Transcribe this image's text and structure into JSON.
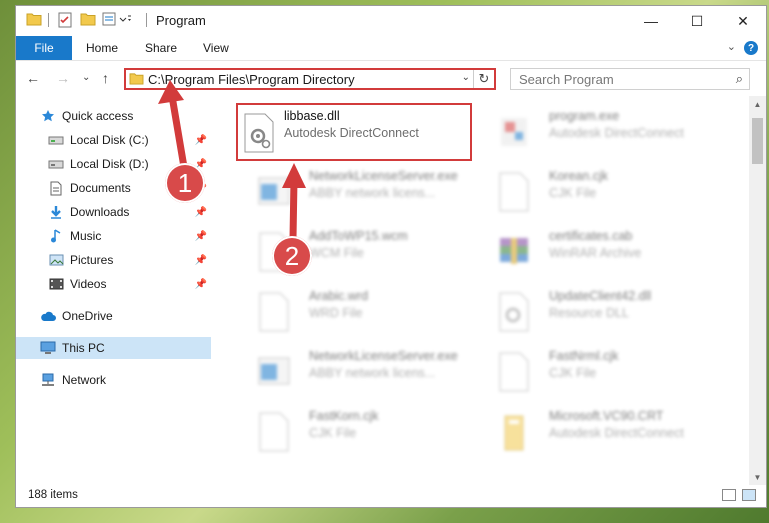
{
  "window": {
    "title": "Program",
    "minimize_glyph": "—",
    "maximize_glyph": "☐",
    "close_glyph": "✕"
  },
  "ribbon": {
    "tabs": [
      "File",
      "Home",
      "Share",
      "View"
    ],
    "help_glyph": "?",
    "collapse_glyph": "⌄"
  },
  "address": {
    "path": "C:\\Program Files\\Program Directory",
    "dropdown_glyph": "⌄",
    "refresh_glyph": "↻"
  },
  "search": {
    "placeholder": "Search Program",
    "icon": "search-icon"
  },
  "nav": {
    "back": "←",
    "forward": "→",
    "recent": "⌄",
    "up": "↑"
  },
  "sidebar": {
    "items": [
      {
        "label": "Quick access",
        "icon": "star-icon",
        "pinned": false,
        "selected": false
      },
      {
        "label": "Local Disk (C:)",
        "icon": "drive-icon",
        "pinned": true,
        "selected": false
      },
      {
        "label": "Local Disk (D:)",
        "icon": "drive-icon",
        "pinned": true,
        "selected": false
      },
      {
        "label": "Documents",
        "icon": "documents-icon",
        "pinned": true,
        "selected": false
      },
      {
        "label": "Downloads",
        "icon": "download-icon",
        "pinned": true,
        "selected": false
      },
      {
        "label": "Music",
        "icon": "music-icon",
        "pinned": true,
        "selected": false
      },
      {
        "label": "Pictures",
        "icon": "pictures-icon",
        "pinned": true,
        "selected": false
      },
      {
        "label": "Videos",
        "icon": "videos-icon",
        "pinned": true,
        "selected": false
      },
      {
        "label": "OneDrive",
        "icon": "cloud-icon",
        "pinned": false,
        "selected": false
      },
      {
        "label": "This PC",
        "icon": "computer-icon",
        "pinned": false,
        "selected": true
      },
      {
        "label": "Network",
        "icon": "network-icon",
        "pinned": false,
        "selected": false
      }
    ]
  },
  "files": [
    {
      "name": "libbase.dll",
      "type": "Autodesk DirectConnect",
      "icon": "dll-gear-icon",
      "highlighted": true
    },
    {
      "name": "program.exe",
      "type": "Autodesk DirectConnect",
      "icon": "exe-icon",
      "highlighted": false
    },
    {
      "name": "NetworkLicenseServer.exe",
      "type": "ABBY network licens...",
      "icon": "window-app-icon",
      "highlighted": false
    },
    {
      "name": "Korean.cjk",
      "type": "CJK File",
      "icon": "blank-file-icon",
      "highlighted": false
    },
    {
      "name": "AddToWP15.wcm",
      "type": "WCM File",
      "icon": "blank-file-icon",
      "highlighted": false
    },
    {
      "name": "certificates.cab",
      "type": "WinRAR Archive",
      "icon": "winrar-icon",
      "highlighted": false
    },
    {
      "name": "Arabic.wrd",
      "type": "WRD File",
      "icon": "blank-file-icon",
      "highlighted": false
    },
    {
      "name": "UpdateClient42.dll",
      "type": "Resource DLL",
      "icon": "dll-gear-icon",
      "highlighted": false
    },
    {
      "name": "NetworkLicenseServer.exe",
      "type": "ABBY network licens...",
      "icon": "window-app-icon",
      "highlighted": false
    },
    {
      "name": "FastNrml.cjk",
      "type": "CJK File",
      "icon": "blank-file-icon",
      "highlighted": false
    },
    {
      "name": "FastKorn.cjk",
      "type": "CJK File",
      "icon": "blank-file-icon",
      "highlighted": false
    },
    {
      "name": "Microsoft.VC90.CRT",
      "type": "Autodesk DirectConnect",
      "icon": "folder-icon",
      "highlighted": false
    }
  ],
  "status": {
    "item_count": "188 items"
  },
  "annotations": {
    "badge1": "1",
    "badge2": "2",
    "color": "#d23b3b"
  },
  "colors": {
    "accent": "#1979ca",
    "selection": "#cce4f7",
    "highlight": "#d23b3b"
  }
}
